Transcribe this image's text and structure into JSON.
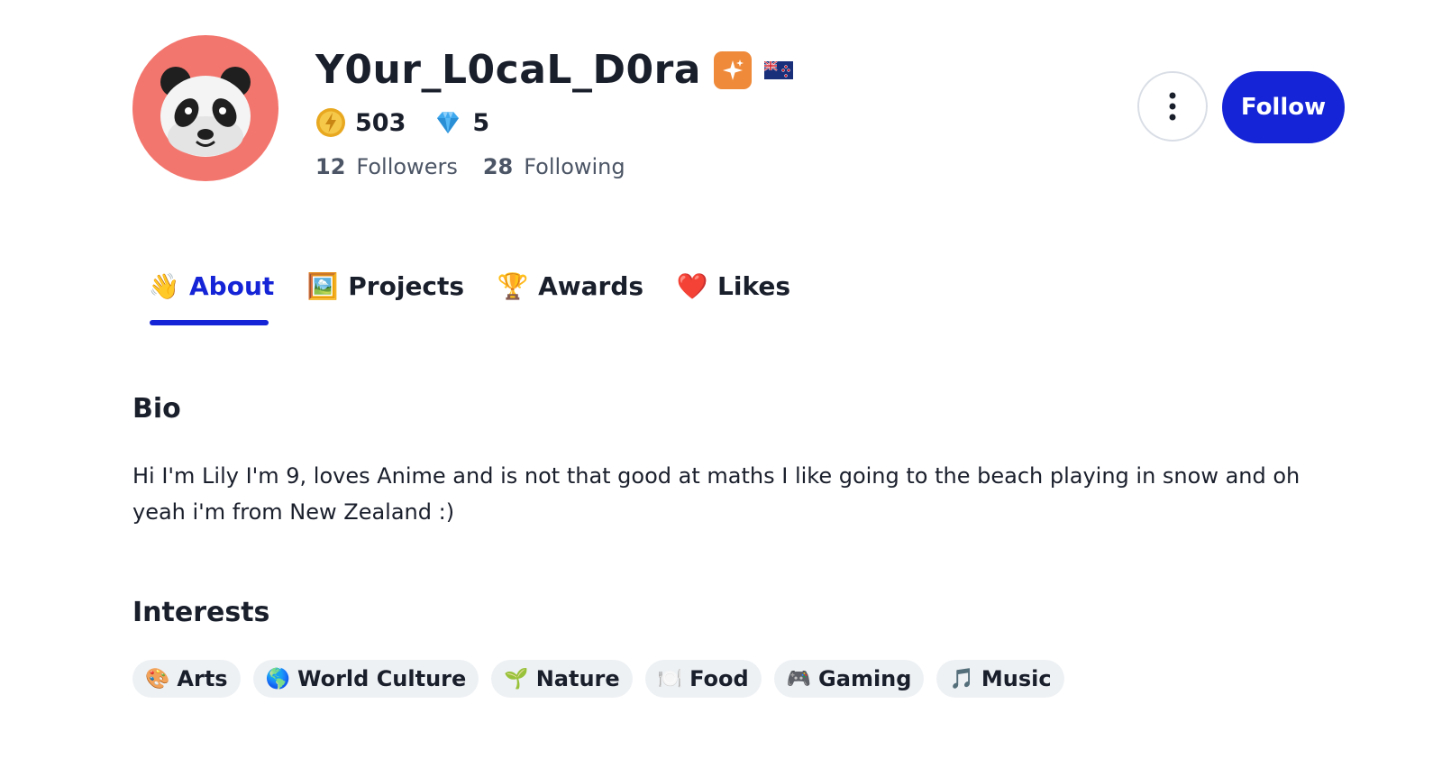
{
  "profile": {
    "username": "Y0ur_L0caL_D0ra",
    "coins": "503",
    "gems": "5",
    "followers_count": "12",
    "followers_label": "Followers",
    "following_count": "28",
    "following_label": "Following"
  },
  "actions": {
    "follow_label": "Follow"
  },
  "tabs": [
    {
      "emoji": "👋",
      "label": "About",
      "active": true
    },
    {
      "emoji": "🖼️",
      "label": "Projects",
      "active": false
    },
    {
      "emoji": "🏆",
      "label": "Awards",
      "active": false
    },
    {
      "emoji": "❤️",
      "label": "Likes",
      "active": false
    }
  ],
  "bio": {
    "title": "Bio",
    "text": "Hi I'm Lily I'm 9, loves Anime and is not that good at maths I like going to the beach playing in snow and oh yeah i'm from New Zealand :)"
  },
  "interests": {
    "title": "Interests",
    "items": [
      {
        "emoji": "🎨",
        "label": "Arts"
      },
      {
        "emoji": "🌎",
        "label": "World Culture"
      },
      {
        "emoji": "🌱",
        "label": "Nature"
      },
      {
        "emoji": "🍽️",
        "label": "Food"
      },
      {
        "emoji": "🎮",
        "label": "Gaming"
      },
      {
        "emoji": "🎵",
        "label": "Music"
      }
    ]
  },
  "colors": {
    "accent": "#1424d6",
    "avatar_bg": "#f3766e",
    "badge_bg": "#ef8a3a",
    "chip_bg": "#eef1f4",
    "text_primary": "#1a1f2c",
    "text_secondary": "#4b5565"
  },
  "icons": {
    "avatar": "panda-avatar",
    "badge": "sparkle-icon",
    "flag": "new-zealand-flag-icon",
    "coins": "lightning-coin-icon",
    "gems": "diamond-icon",
    "more": "more-vertical-icon"
  }
}
